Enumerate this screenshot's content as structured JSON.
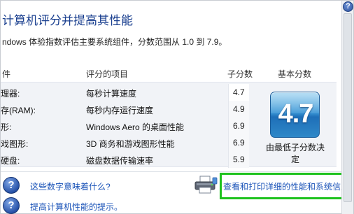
{
  "header": {
    "title": "计算机评分并提高其性能",
    "subtitle": "ndows 体验指数评估主要系统组件，分数范围从 1.0 到 7.9。"
  },
  "table": {
    "columns": {
      "component": "件",
      "rated": "评分的项目",
      "subscore": "子分数",
      "base": "基本分数"
    },
    "rows": [
      {
        "component": "理器:",
        "rated": "每秒计算速度",
        "score": "4.7"
      },
      {
        "component": "存(RAM):",
        "rated": "每秒内存运行速度",
        "score": "4.9"
      },
      {
        "component": "形:",
        "rated": "Windows Aero 的桌面性能",
        "score": "6.9"
      },
      {
        "component": "戏图形:",
        "rated": "3D 商务和游戏图形性能",
        "score": "6.9"
      },
      {
        "component": "硬盘:",
        "rated": "磁盘数据传输速率",
        "score": "5.9"
      }
    ]
  },
  "base_score": {
    "value": "4.7",
    "caption": "由最低子分数决定"
  },
  "links": {
    "what_mean": "这些数字意味着什么?",
    "improve": "提高计算机性能的提示。",
    "print_details": "查看和打印详细的性能和系统信息"
  },
  "colors": {
    "accent": "#1a3f8f",
    "link": "#1a53b8",
    "highlight": "#1ec21e"
  },
  "icons": {
    "help": "help-icon",
    "question": "question-icon",
    "printer": "printer-icon"
  }
}
